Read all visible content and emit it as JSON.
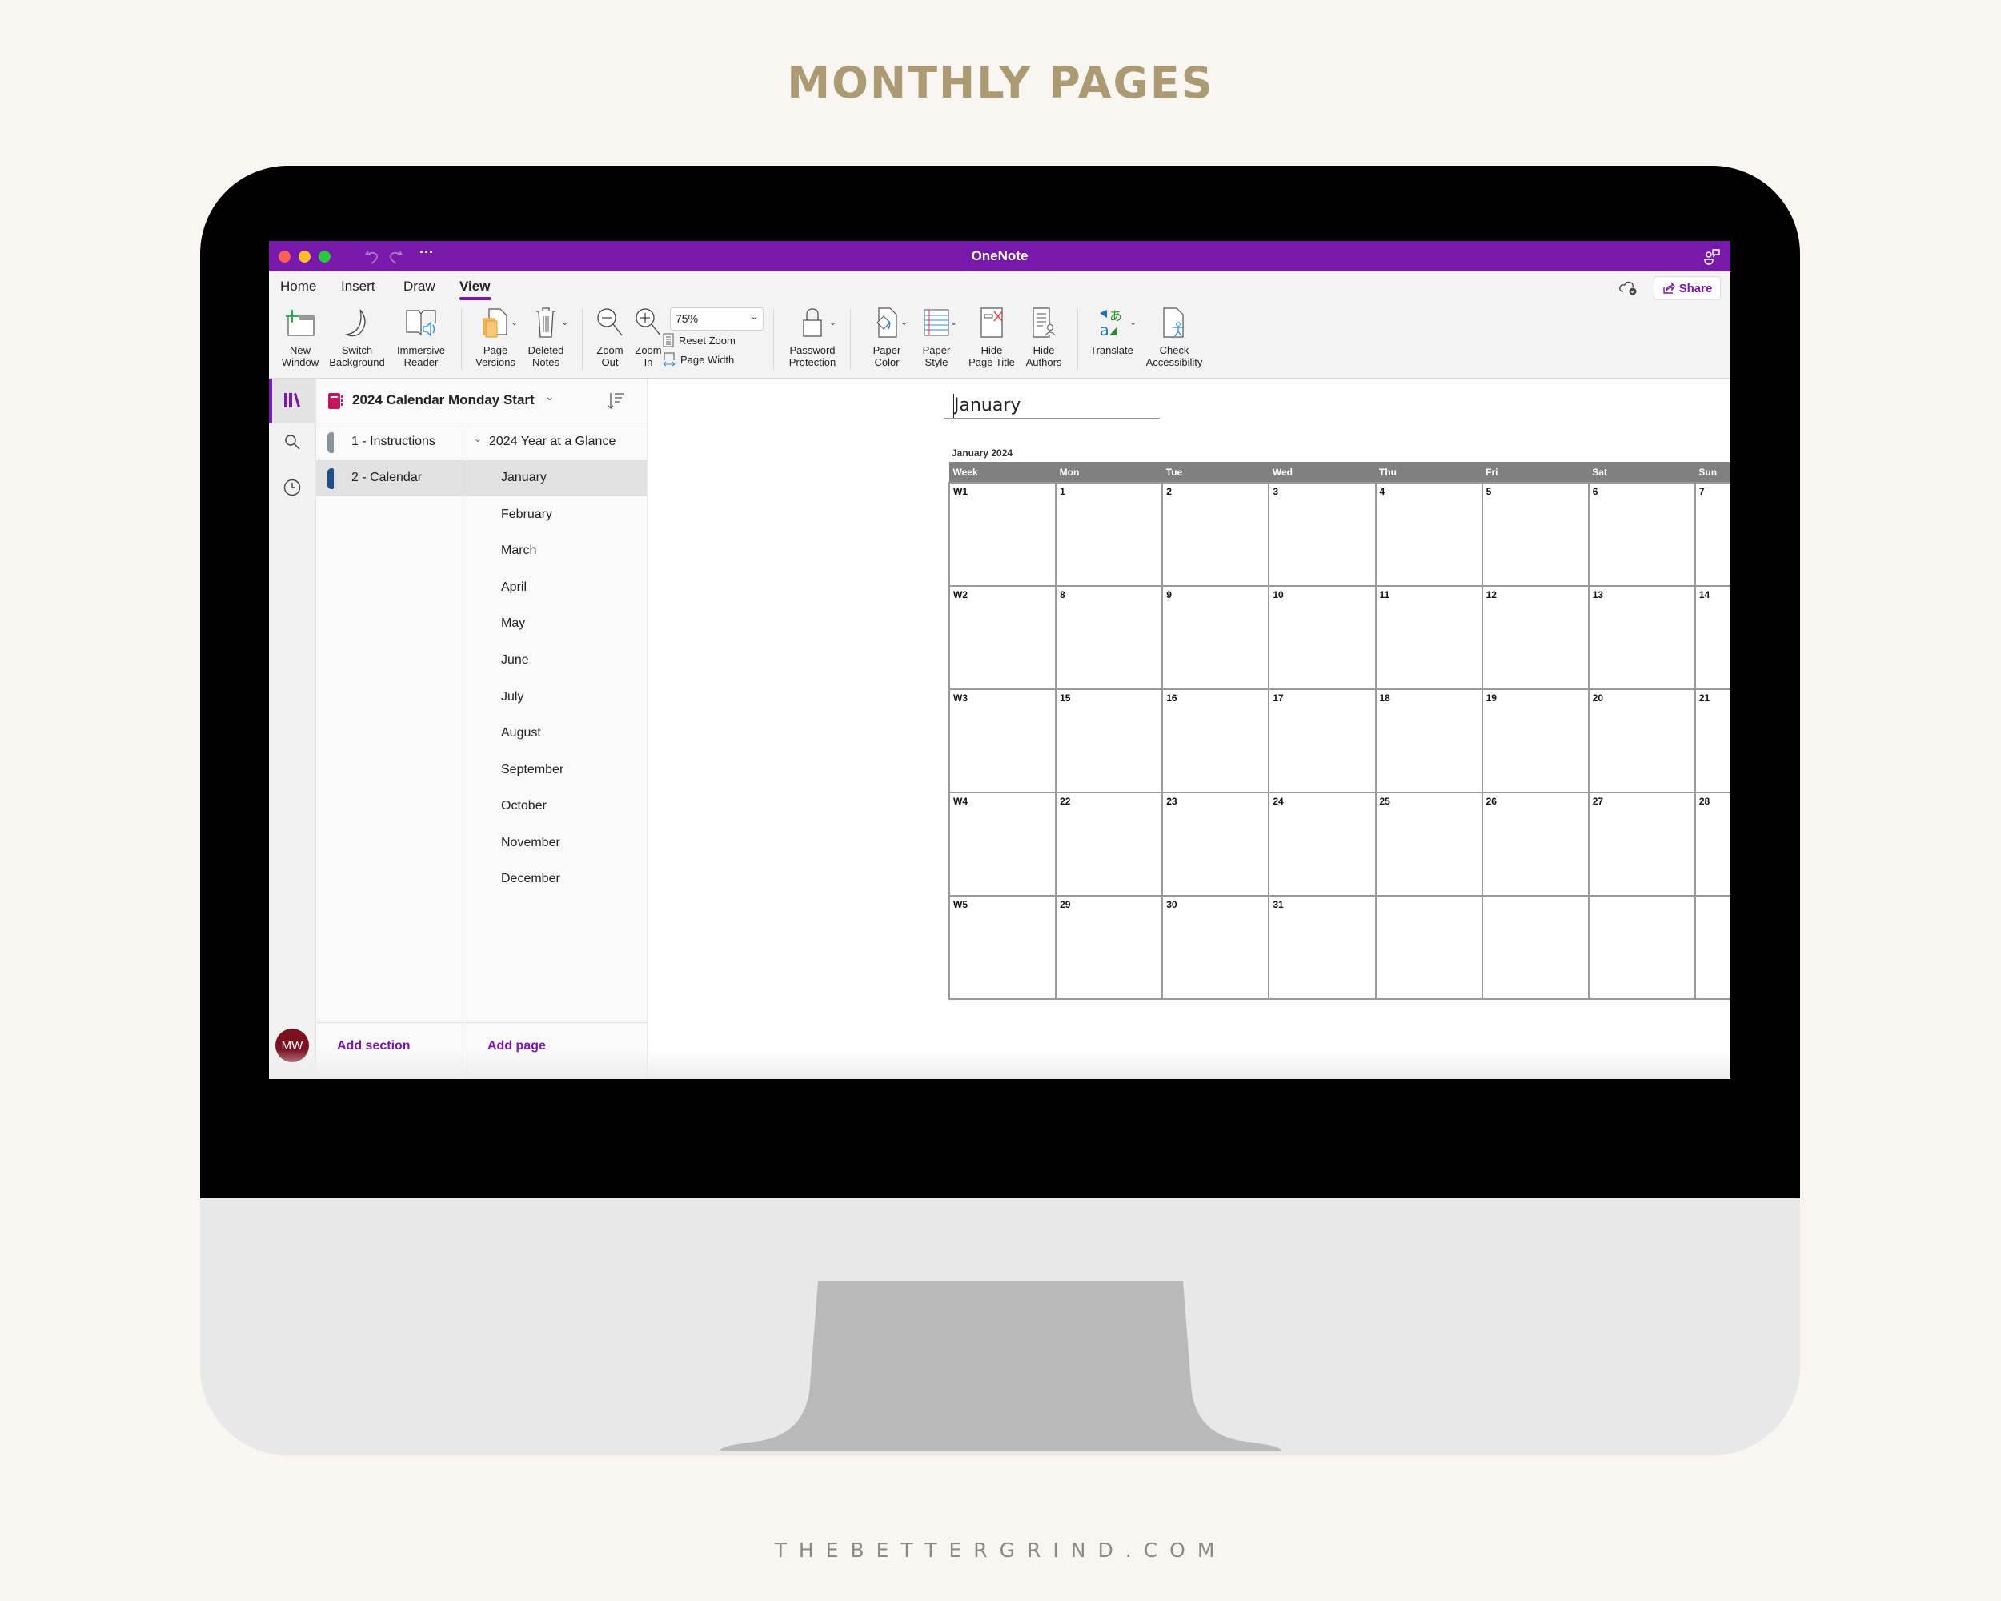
{
  "heading": "MONTHLY PAGES",
  "footer_brand": "THEBETTERGRIND.COM",
  "colors": {
    "brand_purple": "#7719aa",
    "heading_gold": "#ab9a74",
    "avatar": "#7b1020",
    "section_instructions": "#8a9299",
    "section_calendar": "#1e4e8c",
    "notebook_icon": "#c2185b"
  },
  "app": {
    "title": "OneNote",
    "tabs": [
      {
        "label": "Home",
        "active": false
      },
      {
        "label": "Insert",
        "active": false
      },
      {
        "label": "Draw",
        "active": false
      },
      {
        "label": "View",
        "active": true
      }
    ],
    "share_label": "Share",
    "ribbon": {
      "new_window": "New\nWindow",
      "switch_background": "Switch\nBackground",
      "immersive_reader": "Immersive\nReader",
      "page_versions": "Page\nVersions",
      "deleted_notes": "Deleted\nNotes",
      "zoom_out": "Zoom\nOut",
      "zoom_in": "Zoom\nIn",
      "zoom_level": "75%",
      "reset_zoom": "Reset Zoom",
      "page_width": "Page Width",
      "password_protection": "Password\nProtection",
      "paper_color": "Paper\nColor",
      "paper_style": "Paper\nStyle",
      "hide_page_title": "Hide\nPage Title",
      "hide_authors": "Hide\nAuthors",
      "translate": "Translate",
      "check_accessibility": "Check\nAccessibility"
    }
  },
  "navigation": {
    "notebook_name": "2024 Calendar Monday Start",
    "sections": [
      {
        "label": "1 - Instructions",
        "selected": false
      },
      {
        "label": "2 - Calendar",
        "selected": true
      }
    ],
    "pages": [
      {
        "label": "2024 Year at a Glance",
        "group": true,
        "selected": false
      },
      {
        "label": "January",
        "selected": true
      },
      {
        "label": "February",
        "selected": false
      },
      {
        "label": "March",
        "selected": false
      },
      {
        "label": "April",
        "selected": false
      },
      {
        "label": "May",
        "selected": false
      },
      {
        "label": "June",
        "selected": false
      },
      {
        "label": "July",
        "selected": false
      },
      {
        "label": "August",
        "selected": false
      },
      {
        "label": "September",
        "selected": false
      },
      {
        "label": "October",
        "selected": false
      },
      {
        "label": "November",
        "selected": false
      },
      {
        "label": "December",
        "selected": false
      }
    ],
    "add_section": "Add section",
    "add_page": "Add page",
    "avatar_initials": "MW"
  },
  "page": {
    "title": "January",
    "calendar": {
      "caption": "January 2024",
      "headers": [
        "Week",
        "Mon",
        "Tue",
        "Wed",
        "Thu",
        "Fri",
        "Sat",
        "Sun"
      ],
      "rows": [
        [
          "W1",
          "1",
          "2",
          "3",
          "4",
          "5",
          "6",
          "7"
        ],
        [
          "W2",
          "8",
          "9",
          "10",
          "11",
          "12",
          "13",
          "14"
        ],
        [
          "W3",
          "15",
          "16",
          "17",
          "18",
          "19",
          "20",
          "21"
        ],
        [
          "W4",
          "22",
          "23",
          "24",
          "25",
          "26",
          "27",
          "28"
        ],
        [
          "W5",
          "29",
          "30",
          "31",
          "",
          "",
          "",
          ""
        ]
      ]
    }
  }
}
